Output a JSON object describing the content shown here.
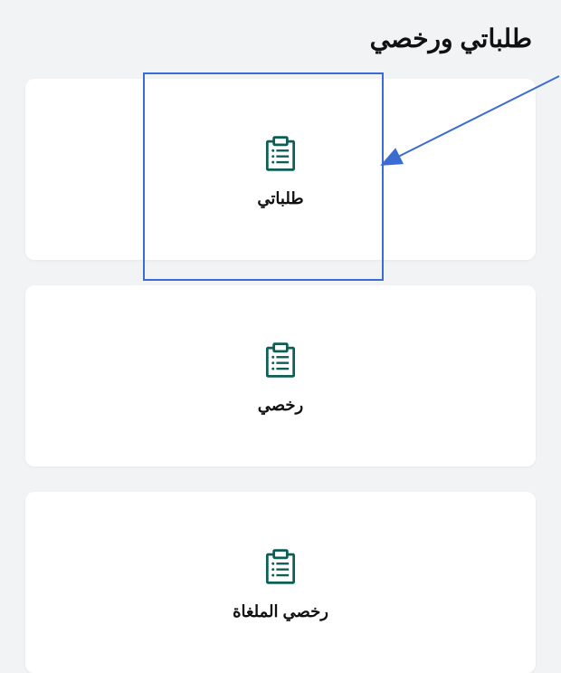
{
  "section_title": "طلباتي ورخصي",
  "cards": [
    {
      "label": "طلباتي"
    },
    {
      "label": "رخصي"
    },
    {
      "label": "رخصي الملغاة"
    }
  ],
  "colors": {
    "icon": "#0d5f55",
    "highlight": "#3b6cd4"
  }
}
